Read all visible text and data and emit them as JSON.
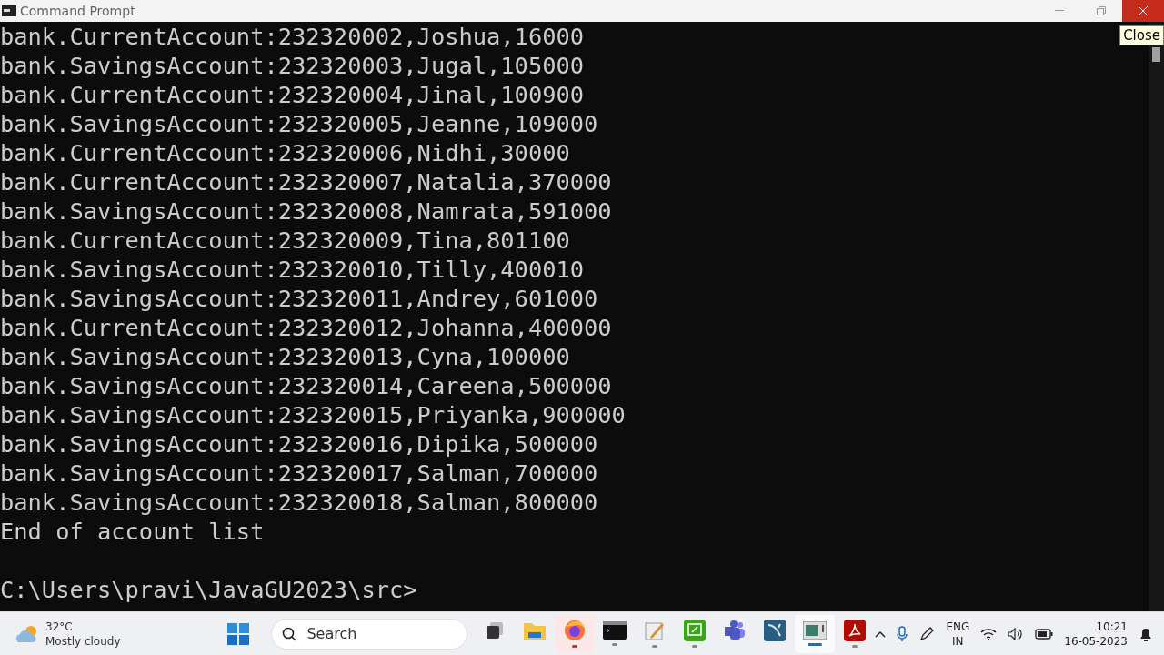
{
  "window": {
    "title": "Command Prompt",
    "close_hovered": true,
    "tooltip": "Close"
  },
  "console": {
    "lines": [
      "bank.CurrentAccount:232320002,Joshua,16000",
      "bank.SavingsAccount:232320003,Jugal,105000",
      "bank.CurrentAccount:232320004,Jinal,100900",
      "bank.SavingsAccount:232320005,Jeanne,109000",
      "bank.CurrentAccount:232320006,Nidhi,30000",
      "bank.CurrentAccount:232320007,Natalia,370000",
      "bank.SavingsAccount:232320008,Namrata,591000",
      "bank.CurrentAccount:232320009,Tina,801100",
      "bank.SavingsAccount:232320010,Tilly,400010",
      "bank.SavingsAccount:232320011,Andrey,601000",
      "bank.CurrentAccount:232320012,Johanna,400000",
      "bank.SavingsAccount:232320013,Cyna,100000",
      "bank.SavingsAccount:232320014,Careena,500000",
      "bank.SavingsAccount:232320015,Priyanka,900000",
      "bank.SavingsAccount:232320016,Dipika,500000",
      "bank.SavingsAccount:232320017,Salman,700000",
      "bank.SavingsAccount:232320018,Salman,800000",
      "End of account list"
    ],
    "prompt": "C:\\Users\\pravi\\JavaGU2023\\src>"
  },
  "taskbar": {
    "weather": {
      "temperature": "32°C",
      "condition": "Mostly cloudy"
    },
    "search": {
      "placeholder": "Search"
    },
    "apps": [
      {
        "kind": "taskview",
        "running": false,
        "attention": false,
        "selected": false
      },
      {
        "kind": "folder",
        "running": false,
        "attention": false,
        "selected": false
      },
      {
        "kind": "browser",
        "running": true,
        "attention": true,
        "selected": false
      },
      {
        "kind": "terminal",
        "running": true,
        "attention": false,
        "selected": false
      },
      {
        "kind": "notepad",
        "running": true,
        "attention": false,
        "selected": false
      },
      {
        "kind": "whiteboard",
        "running": true,
        "attention": false,
        "selected": false
      },
      {
        "kind": "chat",
        "running": false,
        "attention": false,
        "selected": false
      },
      {
        "kind": "dolphin",
        "running": false,
        "attention": false,
        "selected": false
      },
      {
        "kind": "window",
        "running": true,
        "attention": false,
        "selected": true
      },
      {
        "kind": "pdf",
        "running": true,
        "attention": false,
        "selected": false
      }
    ],
    "tray": {
      "language": "ENG",
      "region": "IN",
      "time": "10:21",
      "date": "16-05-2023"
    }
  }
}
